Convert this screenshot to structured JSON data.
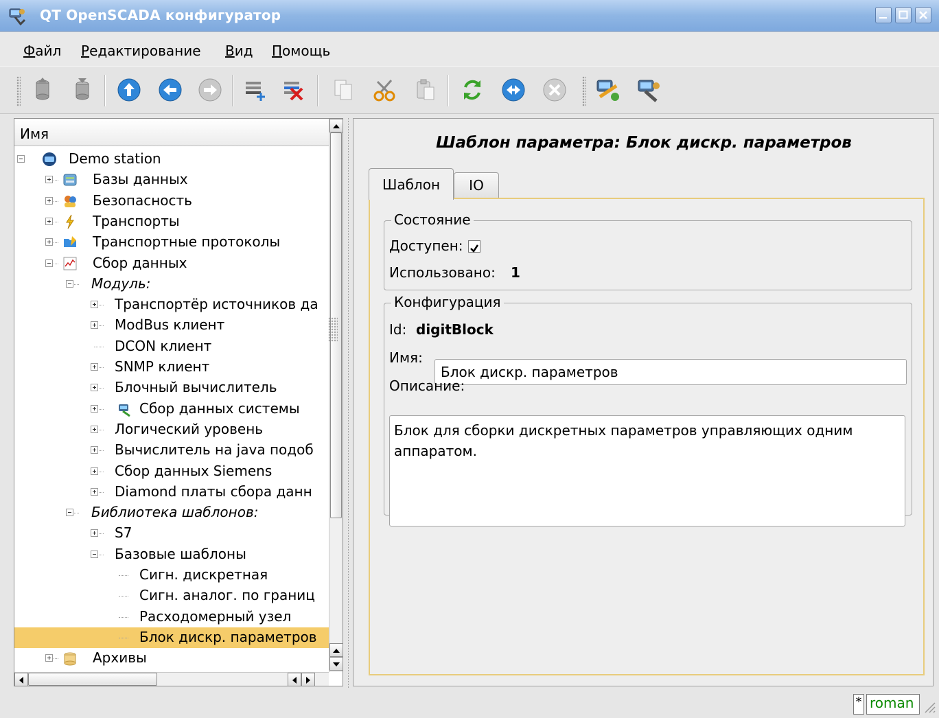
{
  "window": {
    "title": "QT OpenSCADA конфигуратор"
  },
  "menu": [
    {
      "key": "Ф",
      "rest": "айл"
    },
    {
      "key": "Р",
      "rest": "едактирование"
    },
    {
      "key": "В",
      "rest": "ид"
    },
    {
      "key": "П",
      "rest": "омощь"
    }
  ],
  "toolbar": {
    "icons": [
      "db-load-icon",
      "db-save-icon",
      "up-icon",
      "back-icon",
      "forward-icon",
      "add-item-icon",
      "delete-item-icon",
      "copy-icon",
      "cut-icon",
      "paste-icon",
      "refresh-icon",
      "start-icon",
      "stop-icon",
      "connect-icon",
      "station-icon"
    ]
  },
  "tree": {
    "header": "Имя",
    "items": [
      {
        "label": "Demo station",
        "level": 0,
        "expander": "minus",
        "icon": "station-icon"
      },
      {
        "label": "Базы данных",
        "level": 1,
        "expander": "plus",
        "icon": "database-icon"
      },
      {
        "label": "Безопасность",
        "level": 1,
        "expander": "plus",
        "icon": "users-icon"
      },
      {
        "label": "Транспорты",
        "level": 1,
        "expander": "plus",
        "icon": "lightning-icon"
      },
      {
        "label": "Транспортные протоколы",
        "level": 1,
        "expander": "plus",
        "icon": "folder-icon"
      },
      {
        "label": "Сбор данных",
        "level": 1,
        "expander": "minus",
        "icon": "chart-icon"
      },
      {
        "label": "Модуль:",
        "level": 2,
        "expander": "minus",
        "italic": true
      },
      {
        "label": "Транспортёр источников да",
        "level": 3,
        "expander": "plus"
      },
      {
        "label": "ModBus клиент",
        "level": 3,
        "expander": "plus"
      },
      {
        "label": "DCON клиент",
        "level": 3,
        "expander": "none"
      },
      {
        "label": "SNMP клиент",
        "level": 3,
        "expander": "plus"
      },
      {
        "label": "Блочный вычислитель",
        "level": 3,
        "expander": "plus"
      },
      {
        "label": "Сбор данных системы",
        "level": 3,
        "expander": "plus",
        "icon": "system-icon"
      },
      {
        "label": "Логический уровень",
        "level": 3,
        "expander": "plus"
      },
      {
        "label": "Вычислитель на java подоб",
        "level": 3,
        "expander": "plus"
      },
      {
        "label": "Сбор данных Siemens",
        "level": 3,
        "expander": "plus"
      },
      {
        "label": "Diamond платы сбора данн",
        "level": 3,
        "expander": "plus"
      },
      {
        "label": "Библиотека шаблонов:",
        "level": 2,
        "expander": "minus",
        "italic": true
      },
      {
        "label": "S7",
        "level": 3,
        "expander": "plus"
      },
      {
        "label": "Базовые шаблоны",
        "level": 3,
        "expander": "minus"
      },
      {
        "label": "Сигн. дискретная",
        "level": 4,
        "expander": "none"
      },
      {
        "label": "Сигн. аналог. по границ",
        "level": 4,
        "expander": "none"
      },
      {
        "label": "Расходомерный узел",
        "level": 4,
        "expander": "none"
      },
      {
        "label": "Блок дискр. параметров",
        "level": 4,
        "expander": "none",
        "selected": true
      },
      {
        "label": "Архивы",
        "level": 1,
        "expander": "plus",
        "icon": "archive-icon"
      }
    ]
  },
  "panel": {
    "title": "Шаблон параметра: Блок дискр. параметров",
    "tabs": [
      "Шаблон",
      "IO"
    ],
    "active_tab": "Шаблон",
    "state_group": {
      "title": "Состояние",
      "enabled_label": "Доступен:",
      "enabled": true,
      "used_label": "Использовано:",
      "used_value": "1"
    },
    "config_group": {
      "title": "Конфигурация",
      "id_label": "Id:",
      "id_value": "digitBlock",
      "name_label": "Имя:",
      "name_value": "Блок дискр. параметров",
      "description_label": "Описание:",
      "description_line1": "Блок для сборки дискретных параметров управляющих одним",
      "description_line2": "аппаратом."
    }
  },
  "status": {
    "modified_marker": "*",
    "user": "roman"
  }
}
